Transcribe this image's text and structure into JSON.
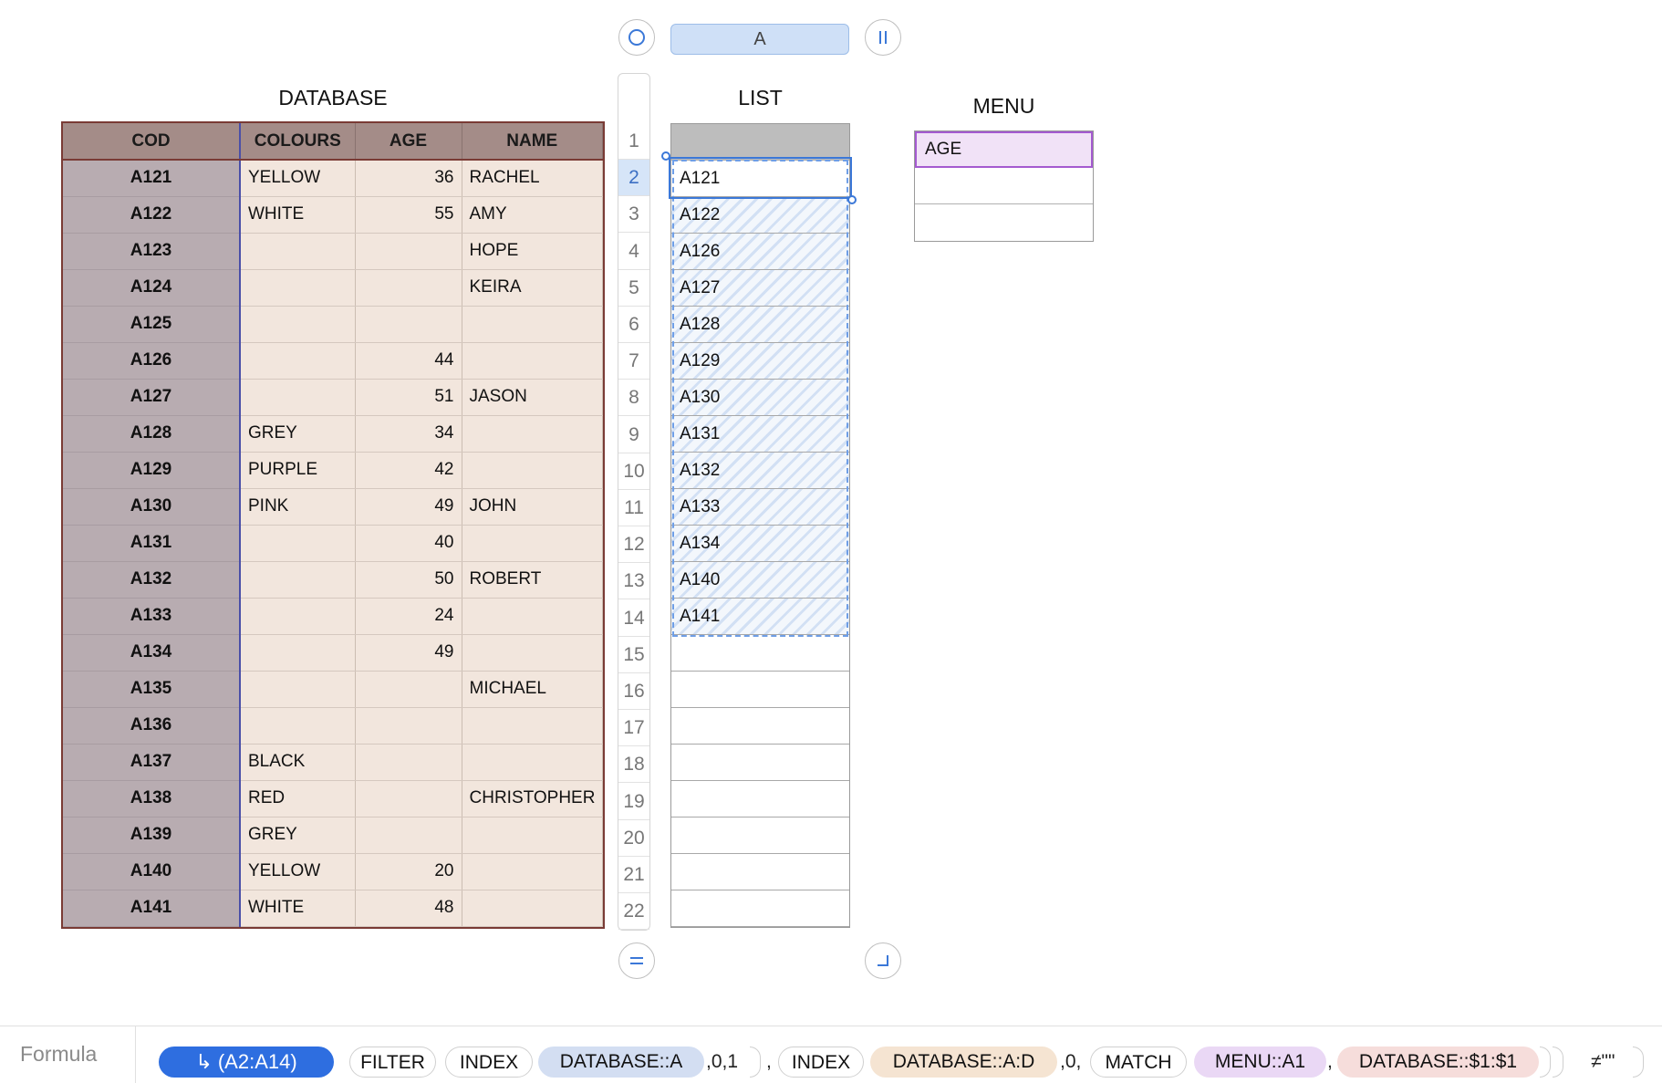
{
  "toolbar": {
    "column_label": "A"
  },
  "database": {
    "title": "DATABASE",
    "headers": [
      "COD",
      "COLOURS",
      "AGE",
      "NAME"
    ],
    "rows": [
      [
        "A121",
        "YELLOW",
        "36",
        "RACHEL"
      ],
      [
        "A122",
        "WHITE",
        "55",
        "AMY"
      ],
      [
        "A123",
        "",
        "",
        "HOPE"
      ],
      [
        "A124",
        "",
        "",
        "KEIRA"
      ],
      [
        "A125",
        "",
        "",
        ""
      ],
      [
        "A126",
        "",
        "44",
        ""
      ],
      [
        "A127",
        "",
        "51",
        "JASON"
      ],
      [
        "A128",
        "GREY",
        "34",
        ""
      ],
      [
        "A129",
        "PURPLE",
        "42",
        ""
      ],
      [
        "A130",
        "PINK",
        "49",
        "JOHN"
      ],
      [
        "A131",
        "",
        "40",
        ""
      ],
      [
        "A132",
        "",
        "50",
        "ROBERT"
      ],
      [
        "A133",
        "",
        "24",
        ""
      ],
      [
        "A134",
        "",
        "49",
        ""
      ],
      [
        "A135",
        "",
        "",
        "MICHAEL"
      ],
      [
        "A136",
        "",
        "",
        ""
      ],
      [
        "A137",
        "BLACK",
        "",
        ""
      ],
      [
        "A138",
        "RED",
        "",
        "CHRISTOPHER"
      ],
      [
        "A139",
        "GREY",
        "",
        ""
      ],
      [
        "A140",
        "YELLOW",
        "20",
        ""
      ],
      [
        "A141",
        "WHITE",
        "48",
        ""
      ]
    ]
  },
  "list": {
    "title": "LIST",
    "row_numbers": [
      "1",
      "2",
      "3",
      "4",
      "5",
      "6",
      "7",
      "8",
      "9",
      "10",
      "11",
      "12",
      "13",
      "14",
      "15",
      "16",
      "17",
      "18",
      "19",
      "20",
      "21",
      "22"
    ],
    "active_row": "2",
    "values": [
      "",
      "A121",
      "A122",
      "A126",
      "A127",
      "A128",
      "A129",
      "A130",
      "A131",
      "A132",
      "A133",
      "A134",
      "A140",
      "A141",
      "",
      "",
      "",
      "",
      "",
      "",
      "",
      ""
    ]
  },
  "menu": {
    "title": "MENU",
    "cells": [
      "AGE",
      "",
      ""
    ]
  },
  "formula_bar": {
    "label": "Formula",
    "target": "↳ (A2:A14)",
    "tokens": {
      "filter": "FILTER",
      "index1": "INDEX",
      "ref_a": "DATABASE::A",
      "args1": ",0,1",
      "comma1": ",",
      "index2": "INDEX",
      "ref_ad": "DATABASE::A:D",
      "args2": ",0,",
      "match": "MATCH",
      "ref_menu": "MENU::A1",
      "comma2": ",",
      "ref_row": "DATABASE::$1:$1",
      "tail": "≠\"\""
    }
  }
}
